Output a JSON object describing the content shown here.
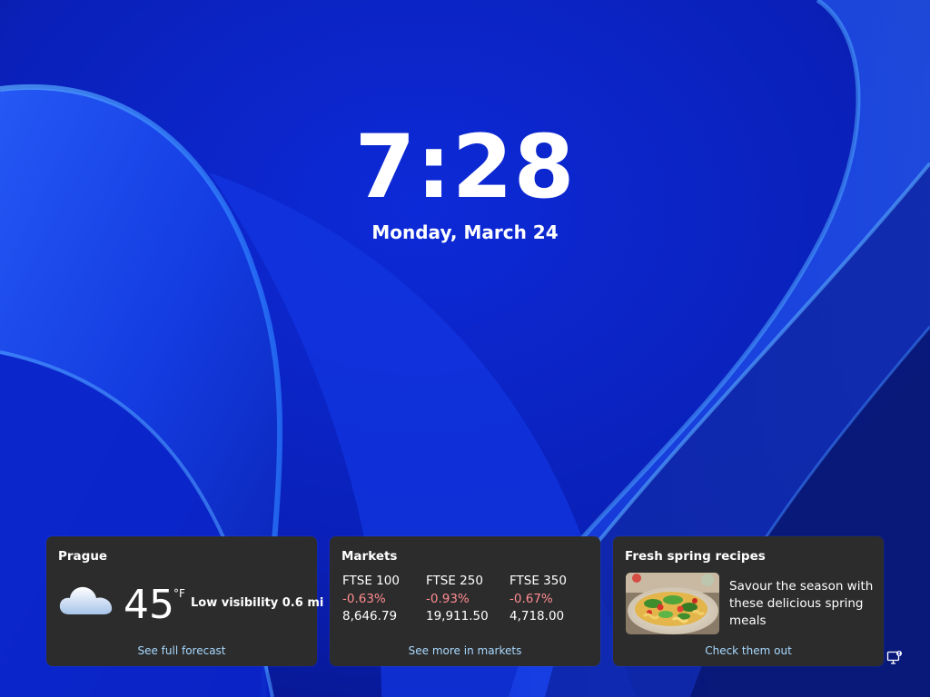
{
  "lock_screen": {
    "time": "7:28",
    "date": "Monday, March 24"
  },
  "weather": {
    "title": "Prague",
    "temperature": "45",
    "unit": "°F",
    "condition": "Low visibility 0.6 mi",
    "link": "See full forecast",
    "icon": "cloud-icon"
  },
  "markets": {
    "title": "Markets",
    "items": [
      {
        "name": "FTSE 100",
        "change": "-0.63%",
        "value": "8,646.79"
      },
      {
        "name": "FTSE 250",
        "change": "-0.93%",
        "value": "19,911.50"
      },
      {
        "name": "FTSE 350",
        "change": "-0.67%",
        "value": "4,718.00"
      }
    ],
    "link": "See more in markets",
    "negative_color": "#ff8c91"
  },
  "recipes": {
    "title": "Fresh spring recipes",
    "description": "Savour the season with these delicious spring meals",
    "link": "Check them out"
  },
  "tray": {
    "icon": "network-icon"
  },
  "colors": {
    "card_background": "#2c2c2c",
    "link": "#a9d9ff",
    "wallpaper_base": "#0a1fb8"
  }
}
